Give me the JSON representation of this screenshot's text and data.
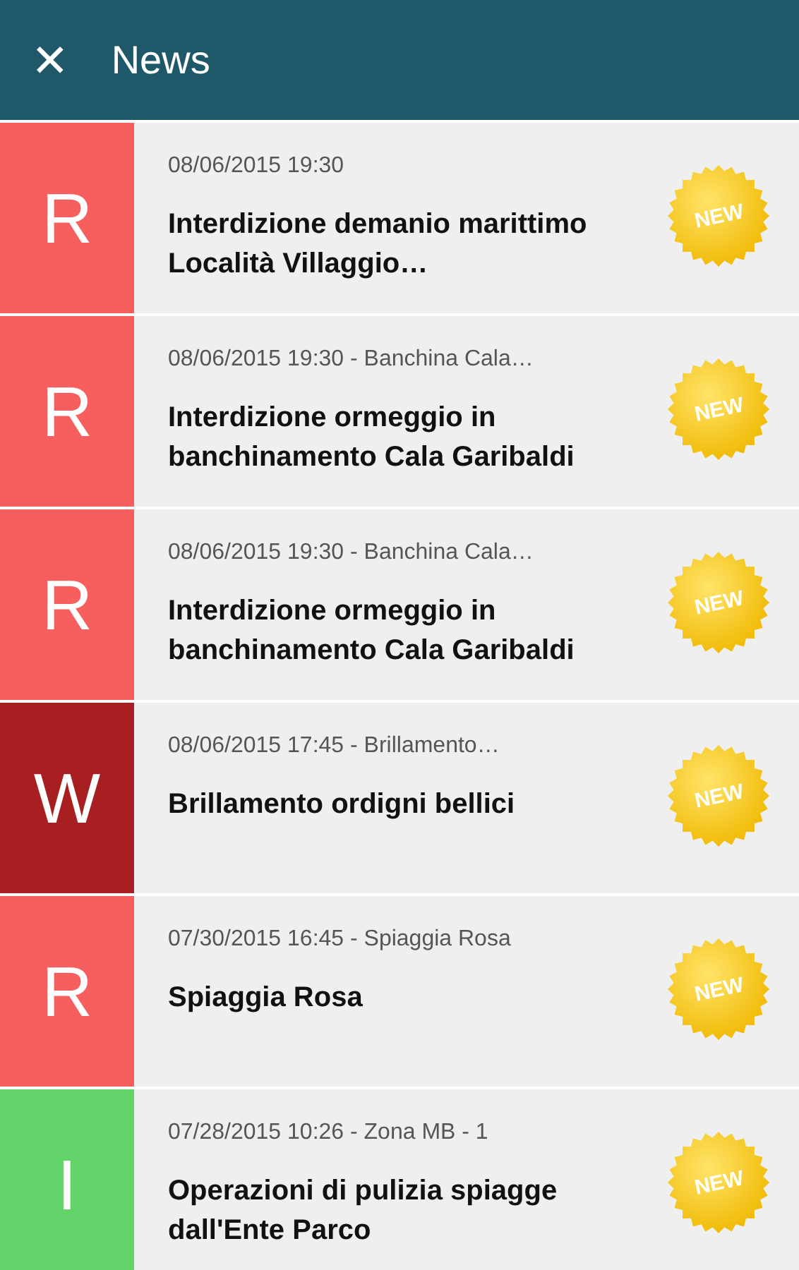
{
  "header": {
    "close": "✕",
    "title": "News"
  },
  "items": [
    {
      "letter": "R",
      "color": "#f75f5f",
      "meta": "08/06/2015 19:30",
      "title": "Interdizione demanio marittimo Località Villaggio…",
      "badge": "NEW"
    },
    {
      "letter": "R",
      "color": "#f75f5f",
      "meta": "08/06/2015 19:30 - Banchina Cala…",
      "title": "Interdizione ormeggio in banchinamento Cala Garibaldi",
      "badge": "NEW"
    },
    {
      "letter": "R",
      "color": "#f75f5f",
      "meta": "08/06/2015 19:30 - Banchina Cala…",
      "title": "Interdizione ormeggio in banchinamento Cala Garibaldi",
      "badge": "NEW"
    },
    {
      "letter": "W",
      "color": "#a81f22",
      "meta": "08/06/2015 17:45 - Brillamento…",
      "title": "Brillamento ordigni bellici",
      "badge": "NEW"
    },
    {
      "letter": "R",
      "color": "#f75f5f",
      "meta": "07/30/2015 16:45 - Spiaggia Rosa",
      "title": "Spiaggia Rosa",
      "badge": "NEW"
    },
    {
      "letter": "I",
      "color": "#63d46a",
      "meta": "07/28/2015 10:26 - Zona MB - 1",
      "title": "Operazioni di pulizia spiagge dall'Ente Parco",
      "badge": "NEW"
    }
  ]
}
